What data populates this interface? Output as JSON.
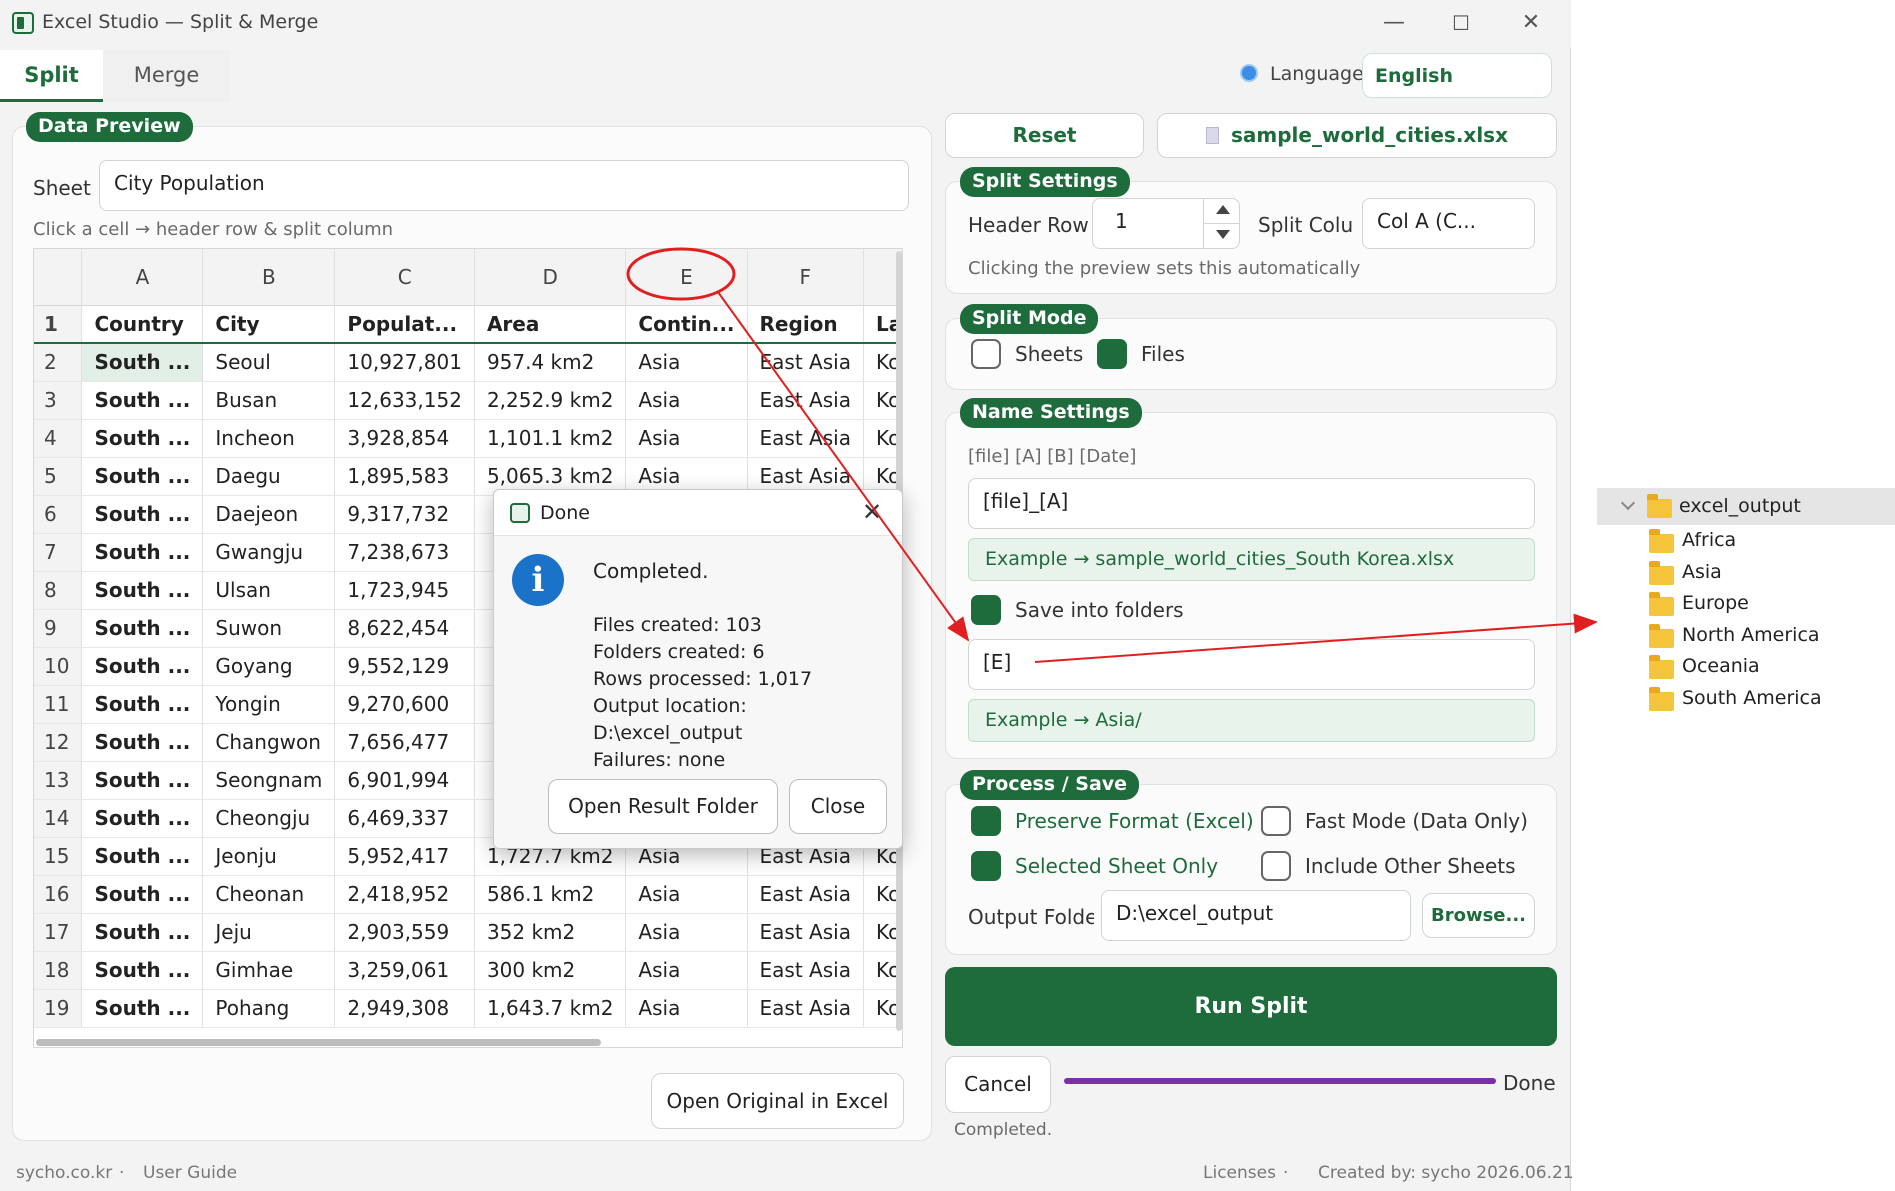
{
  "window": {
    "title": "Excel Studio — Split & Merge"
  },
  "tabs": [
    {
      "label": "Split"
    },
    {
      "label": "Merge"
    }
  ],
  "language": {
    "label": "Language",
    "value": "English"
  },
  "data_preview": {
    "title": "Data Preview",
    "sheet_label": "Sheet",
    "sheet_value": "City Population",
    "hint": "Click a cell → header row & split column",
    "columns": [
      "A",
      "B",
      "C",
      "D",
      "E",
      "F",
      ""
    ],
    "header_row": [
      "1",
      "Country",
      "City",
      "Populat...",
      "Area",
      "Contin...",
      "Region",
      "Lan"
    ],
    "rows": [
      [
        "2",
        "South ...",
        "Seoul",
        "10,927,801",
        "957.4 km2",
        "Asia",
        "East Asia",
        "Kor"
      ],
      [
        "3",
        "South ...",
        "Busan",
        "12,633,152",
        "2,252.9 km2",
        "Asia",
        "East Asia",
        "Kor"
      ],
      [
        "4",
        "South ...",
        "Incheon",
        "3,928,854",
        "1,101.1 km2",
        "Asia",
        "East Asia",
        "Kor"
      ],
      [
        "5",
        "South ...",
        "Daegu",
        "1,895,583",
        "5,065.3 km2",
        "Asia",
        "East Asia",
        "Kor"
      ],
      [
        "6",
        "South ...",
        "Daejeon",
        "9,317,732",
        "",
        "",
        "",
        ""
      ],
      [
        "7",
        "South ...",
        "Gwangju",
        "7,238,673",
        "",
        "",
        "",
        ""
      ],
      [
        "8",
        "South ...",
        "Ulsan",
        "1,723,945",
        "",
        "",
        "",
        ""
      ],
      [
        "9",
        "South ...",
        "Suwon",
        "8,622,454",
        "",
        "",
        "",
        ""
      ],
      [
        "10",
        "South ...",
        "Goyang",
        "9,552,129",
        "",
        "",
        "",
        ""
      ],
      [
        "11",
        "South ...",
        "Yongin",
        "9,270,600",
        "",
        "",
        "",
        ""
      ],
      [
        "12",
        "South ...",
        "Changwon",
        "7,656,477",
        "",
        "",
        "",
        ""
      ],
      [
        "13",
        "South ...",
        "Seongnam",
        "6,901,994",
        "",
        "",
        "",
        ""
      ],
      [
        "14",
        "South ...",
        "Cheongju",
        "6,469,337",
        "",
        "",
        "",
        ""
      ],
      [
        "15",
        "South ...",
        "Jeonju",
        "5,952,417",
        "1,727.7 km2",
        "Asia",
        "East Asia",
        "Kor"
      ],
      [
        "16",
        "South ...",
        "Cheonan",
        "2,418,952",
        "586.1 km2",
        "Asia",
        "East Asia",
        "Kor"
      ],
      [
        "17",
        "South ...",
        "Jeju",
        "2,903,559",
        "352 km2",
        "Asia",
        "East Asia",
        "Kor"
      ],
      [
        "18",
        "South ...",
        "Gimhae",
        "3,259,061",
        "300 km2",
        "Asia",
        "East Asia",
        "Kor"
      ],
      [
        "19",
        "South ...",
        "Pohang",
        "2,949,308",
        "1,643.7 km2",
        "Asia",
        "East Asia",
        "Kor"
      ]
    ],
    "open_original_label": "Open Original in Excel"
  },
  "top_buttons": {
    "reset": "Reset",
    "file": "sample_world_cities.xlsx"
  },
  "split_settings": {
    "title": "Split Settings",
    "header_row_label": "Header Row",
    "header_row_value": "1",
    "split_column_label": "Split Colur",
    "split_column_value": "Col A (C...",
    "hint": "Clicking the preview sets this automatically"
  },
  "split_mode": {
    "title": "Split Mode",
    "sheets": "Sheets",
    "files": "Files",
    "sheets_checked": false,
    "files_checked": true
  },
  "name_settings": {
    "title": "Name Settings",
    "tokens": "[file] [A] [B] [Date]",
    "pattern": "[file]_[A]",
    "example": "Example → sample_world_cities_South Korea.xlsx",
    "save_into_folders": "Save into folders",
    "folder_pattern": "[E]",
    "folder_example": "Example → Asia/"
  },
  "process_save": {
    "title": "Process / Save",
    "preserve_format": "Preserve Format (Excel)",
    "fast_mode": "Fast Mode (Data Only)",
    "selected_sheet_only": "Selected Sheet Only",
    "include_other_sheets": "Include Other Sheets",
    "output_folder_label": "Output Folde",
    "output_folder_value": "D:\\excel_output",
    "browse": "Browse..."
  },
  "run_split": "Run Split",
  "cancel": "Cancel",
  "progress": {
    "label": "Done",
    "value": 1.0,
    "status": "Completed."
  },
  "dialog": {
    "title": "Done",
    "heading": "Completed.",
    "lines": [
      "Files created: 103",
      "Folders created: 6",
      "Rows processed: 1,017",
      "Output location: D:\\excel_output",
      "Failures: none"
    ],
    "open_result": "Open Result Folder",
    "close": "Close"
  },
  "footer": {
    "site": "sycho.co.kr",
    "guide": "User Guide",
    "licenses": "Licenses",
    "created": "Created by: sycho 2026.06.21"
  },
  "explorer": {
    "root": "excel_output",
    "folders": [
      "Africa",
      "Asia",
      "Europe",
      "North America",
      "Oceania",
      "South America"
    ]
  },
  "colors": {
    "accent": "#1e6b3c",
    "annotation": "#e02020",
    "progress": "#7b2fa8"
  }
}
